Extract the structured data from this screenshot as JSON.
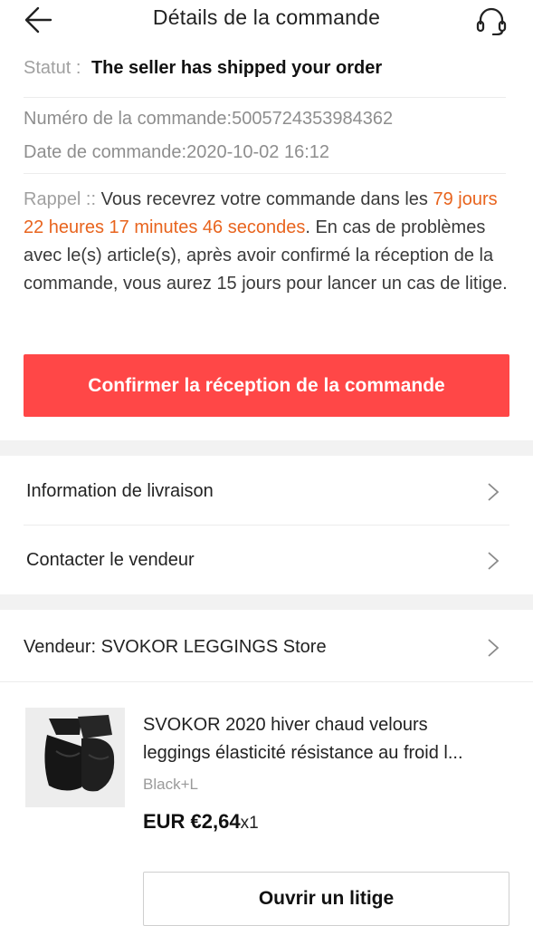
{
  "header": {
    "title": "Détails de la commande",
    "back_icon": "arrow-left-icon",
    "support_icon": "headset-icon"
  },
  "order": {
    "status_label": "Statut :",
    "status_value": "The seller has shipped your order",
    "order_number_text": "Numéro de la commande:5005724353984362",
    "order_date_text": "Date de commande:2020-10-02 16:12"
  },
  "reminder": {
    "label": "Rappel ::",
    "text_before": "Vous recevrez votre commande dans les",
    "countdown": "79 jours 22 heures 17 minutes 46 secondes",
    "text_after": ". En cas de problèmes avec le(s) article(s), après avoir confirmé la réception de la commande, vous aurez 15 jours pour lancer un cas de litige.",
    "accent_color": "#e8641e"
  },
  "actions": {
    "confirm_label": "Confirmer la réception de la commande",
    "confirm_color": "#ff4747",
    "dispute_label": "Ouvrir un litige"
  },
  "menu": {
    "delivery_info": "Information de livraison",
    "contact_seller": "Contacter le vendeur"
  },
  "seller": {
    "label": "Vendeur: SVOKOR LEGGINGS Store"
  },
  "product": {
    "title_line1": "SVOKOR 2020 hiver chaud velours",
    "title_line2": "leggings élasticité résistance au froid l...",
    "variant": "Black+L",
    "price": "EUR €2,64",
    "quantity": "x1"
  }
}
